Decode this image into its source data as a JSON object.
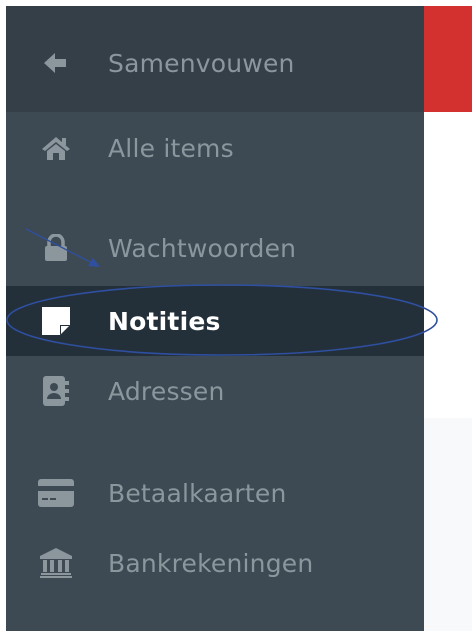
{
  "sidebar": {
    "collapse": {
      "label": "Samenvouwen",
      "icon": "arrow-left-icon"
    },
    "items": [
      {
        "label": "Alle items",
        "icon": "home-icon"
      },
      {
        "label": "Wachtwoorden",
        "icon": "lock-icon"
      },
      {
        "label": "Notities",
        "icon": "note-icon",
        "active": true
      },
      {
        "label": "Adressen",
        "icon": "address-book-icon"
      },
      {
        "label": "Betaalkaarten",
        "icon": "credit-card-icon"
      },
      {
        "label": "Bankrekeningen",
        "icon": "bank-icon"
      }
    ]
  },
  "colors": {
    "sidebar_bg": "#3d4a53",
    "active_bg": "#23303a",
    "label": "#8b969d",
    "active_label": "#ffffff",
    "accent_red": "#d3312f",
    "annotation": "#2f4fa0"
  }
}
